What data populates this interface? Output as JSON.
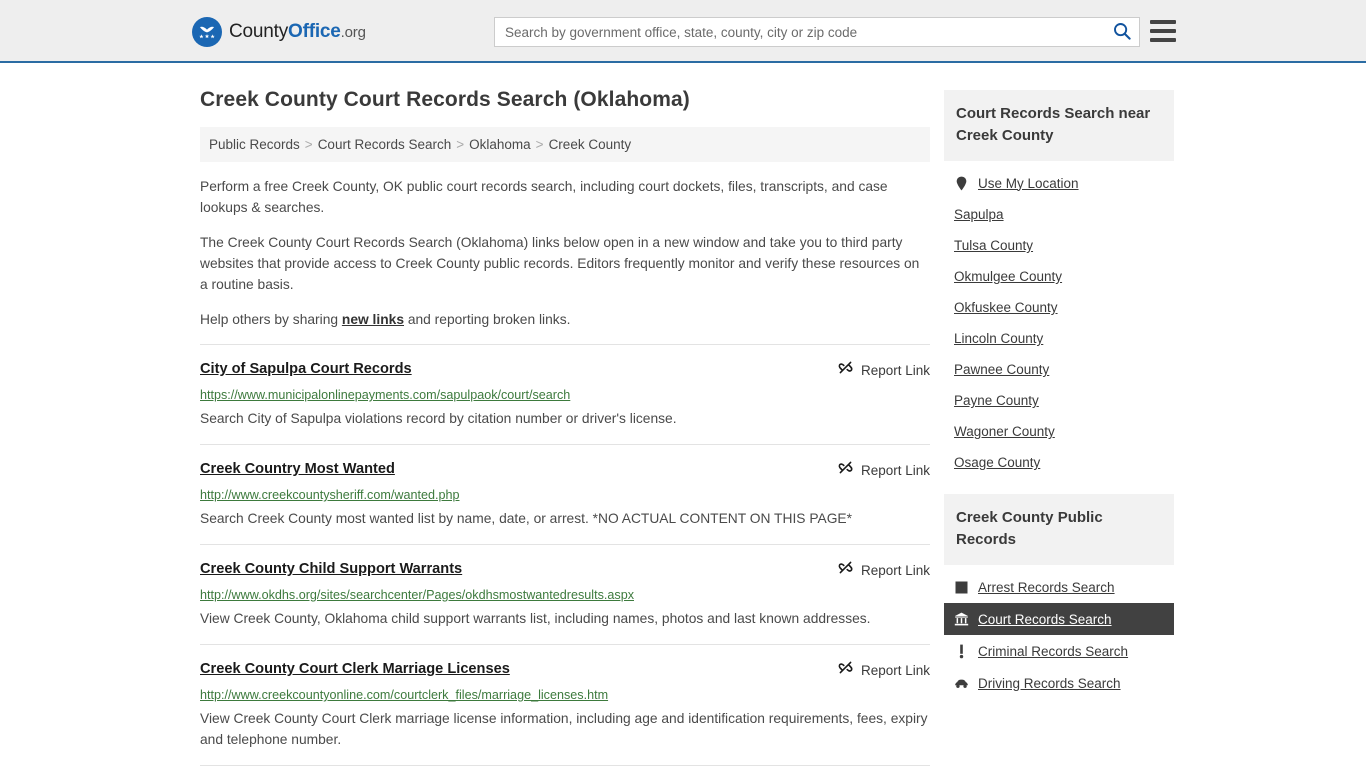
{
  "header": {
    "logo": {
      "text_part1": "County",
      "text_part2": "Office",
      "text_part3": ".org",
      "icon": "eagle-shield-logo"
    },
    "search": {
      "placeholder": "Search by government office, state, county, city or zip code",
      "value": "",
      "search_icon": "search-icon"
    },
    "menu_icon": "hamburger-menu-icon",
    "accent_color": "#1b67b3",
    "background_color": "#eeeeee"
  },
  "page": {
    "title": "Creek County Court Records Search (Oklahoma)",
    "breadcrumb": [
      "Public Records",
      "Court Records Search",
      "Oklahoma",
      "Creek County"
    ],
    "breadcrumb_separator": ">",
    "intro": {
      "paragraph1": "Perform a free Creek County, OK public court records search, including court dockets, files, transcripts, and case lookups & searches.",
      "paragraph2": "The Creek County Court Records Search (Oklahoma) links below open in a new window and take you to third party websites that provide access to Creek County public records. Editors frequently monitor and verify these resources on a routine basis.",
      "paragraph3_before": "Help others by sharing ",
      "paragraph3_link": "new links",
      "paragraph3_after": " and reporting broken links."
    }
  },
  "results": {
    "report_label": "Report Link",
    "report_icon": "broken-link-icon",
    "items": [
      {
        "title": "City of Sapulpa Court Records",
        "url": "https://www.municipalonlinepayments.com/sapulpaok/court/search",
        "description": "Search City of Sapulpa violations record by citation number or driver's license."
      },
      {
        "title": "Creek Country Most Wanted",
        "url": "http://www.creekcountysheriff.com/wanted.php",
        "description": "Search Creek County most wanted list by name, date, or arrest. *NO ACTUAL CONTENT ON THIS PAGE*"
      },
      {
        "title": "Creek County Child Support Warrants",
        "url": "http://www.okdhs.org/sites/searchcenter/Pages/okdhsmostwantedresults.aspx",
        "description": "View Creek County, Oklahoma child support warrants list, including names, photos and last known addresses."
      },
      {
        "title": "Creek County Court Clerk Marriage Licenses",
        "url": "http://www.creekcountyonline.com/courtclerk_files/marriage_licenses.htm",
        "description": "View Creek County Court Clerk marriage license information, including age and identification requirements, fees, expiry and telephone number."
      }
    ]
  },
  "sidebar": {
    "nearby": {
      "heading": "Court Records Search near Creek County",
      "items": [
        {
          "label": "Use My Location",
          "icon": "map-pin-icon",
          "active": false
        },
        {
          "label": "Sapulpa",
          "icon": "",
          "active": false
        },
        {
          "label": "Tulsa County",
          "icon": "",
          "active": false
        },
        {
          "label": "Okmulgee County",
          "icon": "",
          "active": false
        },
        {
          "label": "Okfuskee County",
          "icon": "",
          "active": false
        },
        {
          "label": "Lincoln County",
          "icon": "",
          "active": false
        },
        {
          "label": "Pawnee County",
          "icon": "",
          "active": false
        },
        {
          "label": "Payne County",
          "icon": "",
          "active": false
        },
        {
          "label": "Wagoner County",
          "icon": "",
          "active": false
        },
        {
          "label": "Osage County",
          "icon": "",
          "active": false
        }
      ]
    },
    "public_records": {
      "heading": "Creek County Public Records",
      "items": [
        {
          "label": "Arrest Records Search",
          "icon": "square-icon",
          "active": false
        },
        {
          "label": "Court Records Search",
          "icon": "courthouse-icon",
          "active": true
        },
        {
          "label": "Criminal Records Search",
          "icon": "exclamation-icon",
          "active": false
        },
        {
          "label": "Driving Records Search",
          "icon": "car-icon",
          "active": false
        }
      ]
    },
    "active_background": "#414141"
  }
}
